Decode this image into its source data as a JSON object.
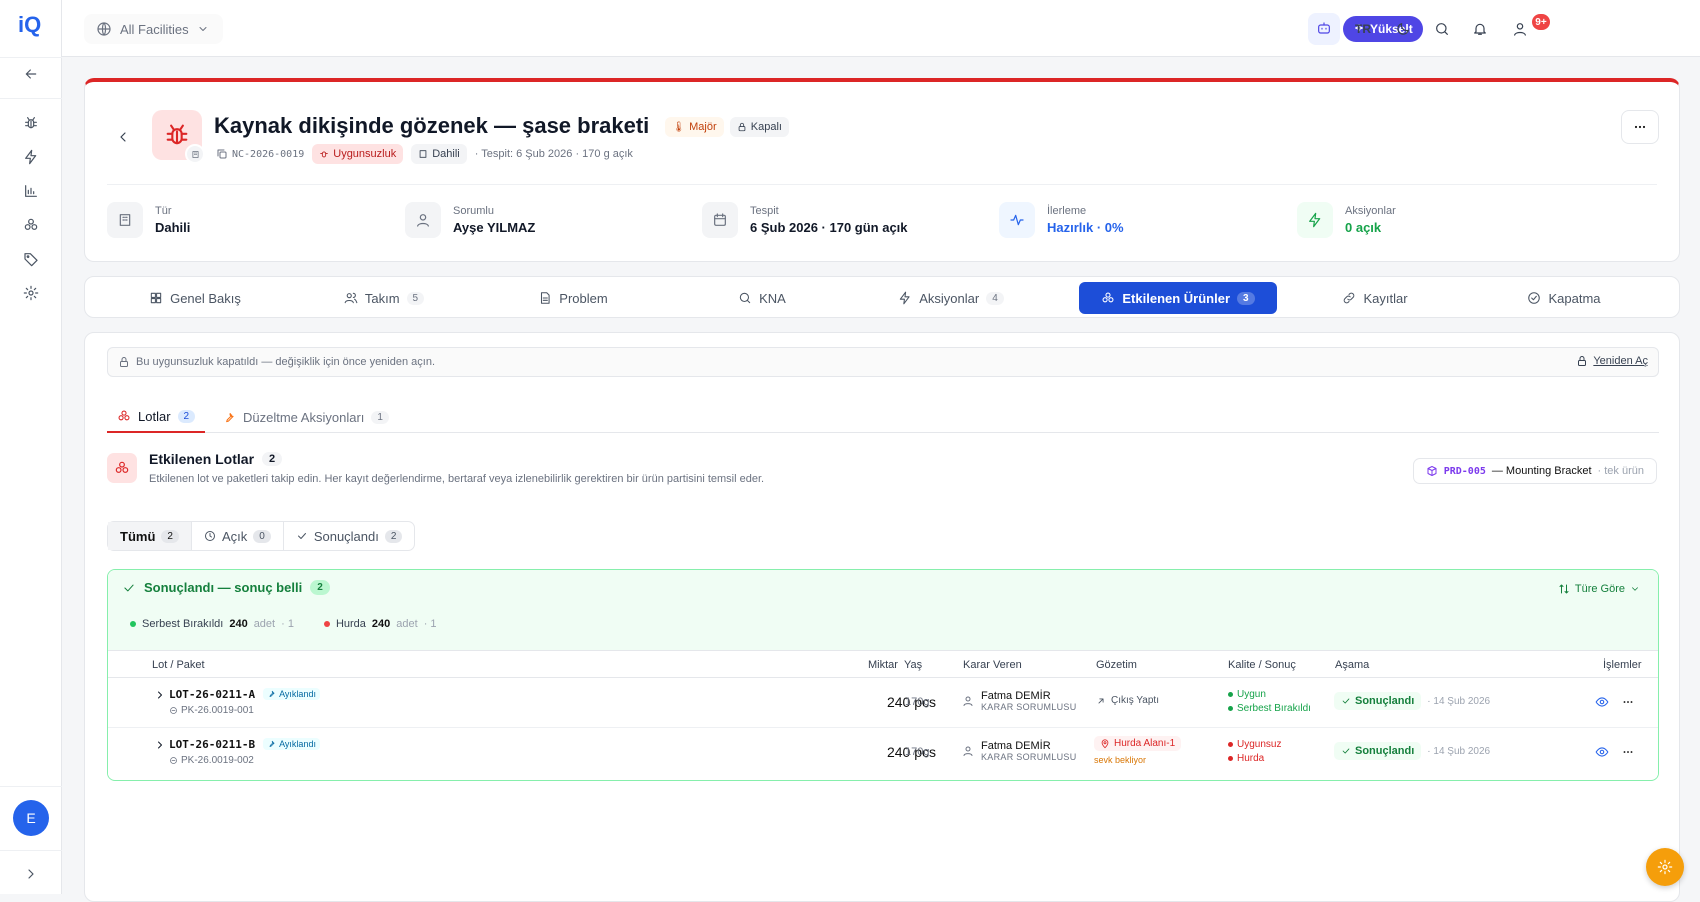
{
  "app": {
    "logo_text": "iQ"
  },
  "topbar": {
    "facility": "All Facilities",
    "upgrade_label": "Yükselt",
    "lang": "TR",
    "notif_count": "9+"
  },
  "sidebar": {
    "avatar_initial": "E"
  },
  "header": {
    "title": "Kaynak dikişinde gözenek — şase braketi",
    "severity": "Majör",
    "status": "Kapalı",
    "code": "NC-2026-0019",
    "type_tag": "Uygunsuzluk",
    "scope_tag": "Dahili",
    "detected": "· Tespit: 6 Şub 2026 · 170 g açık",
    "stats": [
      {
        "label": "Tür",
        "value": "Dahili"
      },
      {
        "label": "Sorumlu",
        "value": "Ayşe YILMAZ"
      },
      {
        "label": "Tespit",
        "value": "6 Şub 2026 · 170 gün açık"
      },
      {
        "label": "İlerleme",
        "value": "Hazırlık · 0%"
      },
      {
        "label": "Aksiyonlar",
        "value": "0 açık"
      }
    ]
  },
  "tabs": [
    {
      "label": "Genel Bakış",
      "count": ""
    },
    {
      "label": "Takım",
      "count": "5"
    },
    {
      "label": "Problem",
      "count": ""
    },
    {
      "label": "KNA",
      "count": ""
    },
    {
      "label": "Aksiyonlar",
      "count": "4"
    },
    {
      "label": "Etkilenen Ürünler",
      "count": "3"
    },
    {
      "label": "Kayıtlar",
      "count": ""
    },
    {
      "label": "Kapatma",
      "count": ""
    }
  ],
  "notice": {
    "text": "Bu uygunsuzluk kapatıldı — değişiklik için önce yeniden açın.",
    "reopen": "Yeniden Aç"
  },
  "subtabs": [
    {
      "label": "Lotlar",
      "count": "2"
    },
    {
      "label": "Düzeltme Aksiyonları",
      "count": "1"
    }
  ],
  "section": {
    "title": "Etkilenen Lotlar",
    "count": "2",
    "desc": "Etkilenen lot ve paketleri takip edin. Her kayıt değerlendirme, bertaraf veya izlenebilirlik gerektiren bir ürün partisini temsil eder.",
    "product_code": "PRD-005",
    "product_name": "— Mounting Bracket",
    "product_hint": "· tek ürün"
  },
  "filters": [
    {
      "label": "Tümü",
      "count": "2"
    },
    {
      "label": "Açık",
      "count": "0"
    },
    {
      "label": "Sonuçlandı",
      "count": "2"
    }
  ],
  "group": {
    "title": "Sonuçlandı — sonuç belli",
    "count": "2",
    "sort": "Türe Göre",
    "summary": [
      {
        "label": "Serbest Bırakıldı",
        "qty": "240",
        "unit": "adet",
        "n": "· 1",
        "color": "#22c55e"
      },
      {
        "label": "Hurda",
        "qty": "240",
        "unit": "adet",
        "n": "· 1",
        "color": "#ef4444"
      }
    ]
  },
  "table": {
    "headers": {
      "lot": "Lot / Paket",
      "qty": "Miktar",
      "age": "Yaş",
      "decider": "Karar Veren",
      "custody": "Gözetim",
      "quality": "Kalite / Sonuç",
      "stage": "Aşama",
      "actions": "İşlemler"
    },
    "rows": [
      {
        "lot": "LOT-26-0211-A",
        "tag": "Ayıklandı",
        "pk": "PK-26.0019-001",
        "qty": "240 pcs",
        "age": "170g",
        "person": "Fatma DEMİR",
        "role": "KARAR SORUMLUSU",
        "custody": "Çıkış Yaptı",
        "custody_note": "",
        "q1": "Uygun",
        "q1_color": "#16a34a",
        "q2": "Serbest Bırakıldı",
        "q2_color": "#16a34a",
        "stage": "Sonuçlandı",
        "date": "· 14 Şub 2026"
      },
      {
        "lot": "LOT-26-0211-B",
        "tag": "Ayıklandı",
        "pk": "PK-26.0019-002",
        "qty": "240 pcs",
        "age": "170g",
        "person": "Fatma DEMİR",
        "role": "KARAR SORUMLUSU",
        "custody": "Hurda Alanı-1",
        "custody_note": "sevk bekliyor",
        "q1": "Uygunsuz",
        "q1_color": "#dc2626",
        "q2": "Hurda",
        "q2_color": "#dc2626",
        "stage": "Sonuçlandı",
        "date": "· 14 Şub 2026"
      }
    ]
  }
}
